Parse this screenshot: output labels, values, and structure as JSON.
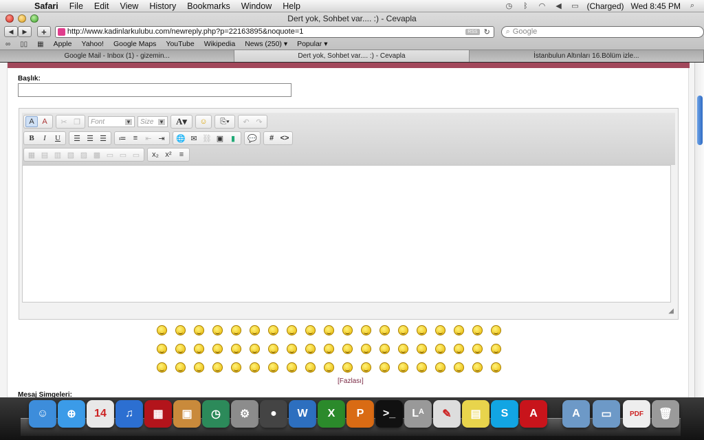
{
  "menubar": {
    "apple": "",
    "items": [
      "Safari",
      "File",
      "Edit",
      "View",
      "History",
      "Bookmarks",
      "Window",
      "Help"
    ],
    "status": {
      "battery": "(Charged)",
      "clock": "Wed 8:45 PM"
    }
  },
  "window": {
    "title": "Dert yok, Sohbet var.... :) - Cevapla"
  },
  "toolbar": {
    "url": "http://www.kadinlarkulubu.com/newreply.php?p=22163895&noquote=1",
    "rss": "RSS",
    "search_placeholder": "Google"
  },
  "bookmarks": [
    "Apple",
    "Yahoo!",
    "Google Maps",
    "YouTube",
    "Wikipedia",
    "News (250) ▾",
    "Popular ▾"
  ],
  "tabs": [
    {
      "label": "Google Mail - Inbox (1) - gizemin..."
    },
    {
      "label": "Dert yok, Sohbet var.... :) - Cevapla"
    },
    {
      "label": "İstanbulun Altınları 16.Bölüm izle..."
    }
  ],
  "form": {
    "title_label": "Başlık:",
    "title_value": "",
    "font_placeholder": "Font",
    "size_placeholder": "Size",
    "more_link": "[Fazlası]",
    "icons_label": "Mesaj Simgeleri:"
  },
  "accent_colors": {
    "header_bar": "#a2485b",
    "scroll_thumb": "#2e6ac4"
  }
}
